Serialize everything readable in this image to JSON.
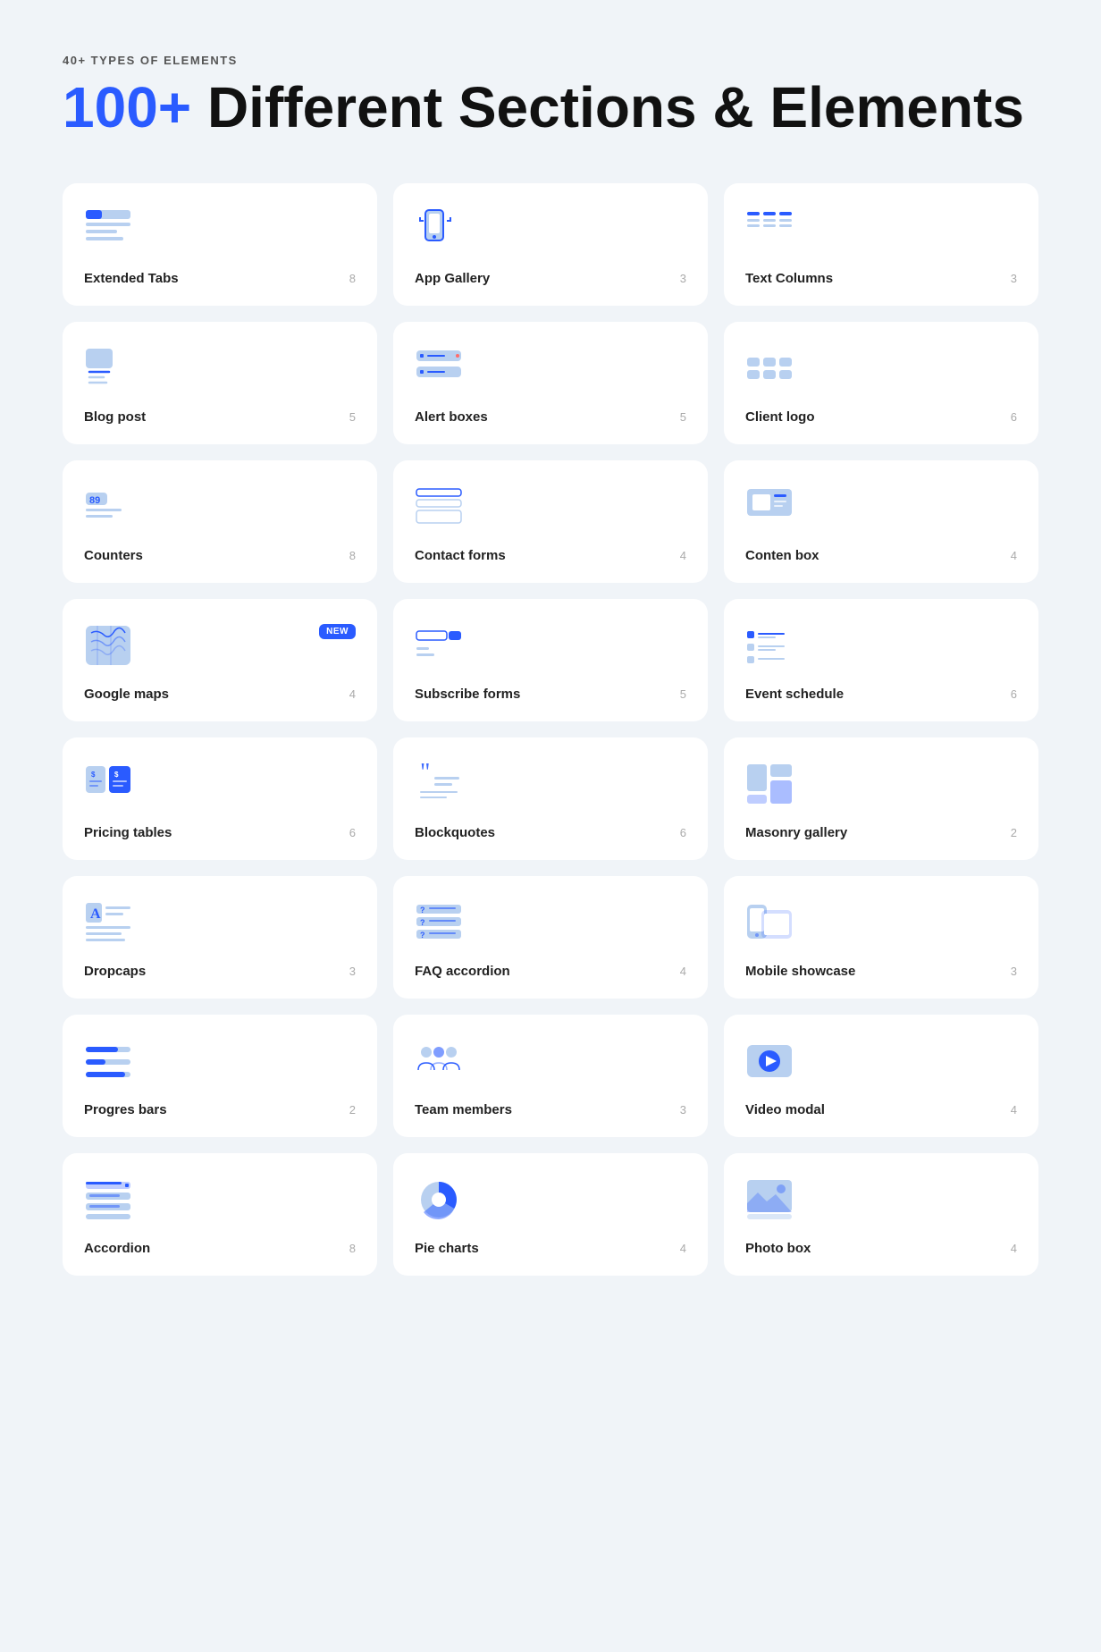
{
  "header": {
    "subtitle": "40+ Types of Elements",
    "title_highlight": "100+",
    "title_rest": " Different Sections & Elements"
  },
  "cards": [
    {
      "id": "extended-tabs",
      "label": "Extended Tabs",
      "count": 8,
      "icon": "tabs",
      "new": false
    },
    {
      "id": "app-gallery",
      "label": "App Gallery",
      "count": 3,
      "icon": "phone",
      "new": false
    },
    {
      "id": "text-columns",
      "label": "Text Columns",
      "count": 3,
      "icon": "columns",
      "new": false
    },
    {
      "id": "blog-post",
      "label": "Blog post",
      "count": 5,
      "icon": "blogpost",
      "new": false
    },
    {
      "id": "alert-boxes",
      "label": "Alert boxes",
      "count": 5,
      "icon": "alert",
      "new": false
    },
    {
      "id": "client-logo",
      "label": "Client logo",
      "count": 6,
      "icon": "logo",
      "new": false
    },
    {
      "id": "counters",
      "label": "Counters",
      "count": 8,
      "icon": "counter",
      "new": false
    },
    {
      "id": "contact-forms",
      "label": "Contact forms",
      "count": 4,
      "icon": "contactform",
      "new": false
    },
    {
      "id": "conten-box",
      "label": "Conten box",
      "count": 4,
      "icon": "contenbox",
      "new": false
    },
    {
      "id": "google-maps",
      "label": "Google maps",
      "count": 4,
      "icon": "map",
      "new": true
    },
    {
      "id": "subscribe-forms",
      "label": "Subscribe forms",
      "count": 5,
      "icon": "subscribe",
      "new": false
    },
    {
      "id": "event-schedule",
      "label": "Event schedule",
      "count": 6,
      "icon": "schedule",
      "new": false
    },
    {
      "id": "pricing-tables",
      "label": "Pricing tables",
      "count": 6,
      "icon": "pricing",
      "new": false
    },
    {
      "id": "blockquotes",
      "label": "Blockquotes",
      "count": 6,
      "icon": "blockquote",
      "new": false
    },
    {
      "id": "masonry-gallery",
      "label": "Masonry gallery",
      "count": 2,
      "icon": "masonry",
      "new": false
    },
    {
      "id": "dropcaps",
      "label": "Dropcaps",
      "count": 3,
      "icon": "dropcap",
      "new": false
    },
    {
      "id": "faq-accordion",
      "label": "FAQ accordion",
      "count": 4,
      "icon": "faq",
      "new": false
    },
    {
      "id": "mobile-showcase",
      "label": "Mobile showcase",
      "count": 3,
      "icon": "mobileshowcase",
      "new": false
    },
    {
      "id": "progres-bars",
      "label": "Progres bars",
      "count": 2,
      "icon": "progressbar",
      "new": false
    },
    {
      "id": "team-members",
      "label": "Team members",
      "count": 3,
      "icon": "team",
      "new": false
    },
    {
      "id": "video-modal",
      "label": "Video modal",
      "count": 4,
      "icon": "video",
      "new": false
    },
    {
      "id": "accordion",
      "label": "Accordion",
      "count": 8,
      "icon": "accordion",
      "new": false
    },
    {
      "id": "pie-charts",
      "label": "Pie charts",
      "count": 4,
      "icon": "piechart",
      "new": false
    },
    {
      "id": "photo-box",
      "label": "Photo box",
      "count": 4,
      "icon": "photobox",
      "new": false
    }
  ]
}
